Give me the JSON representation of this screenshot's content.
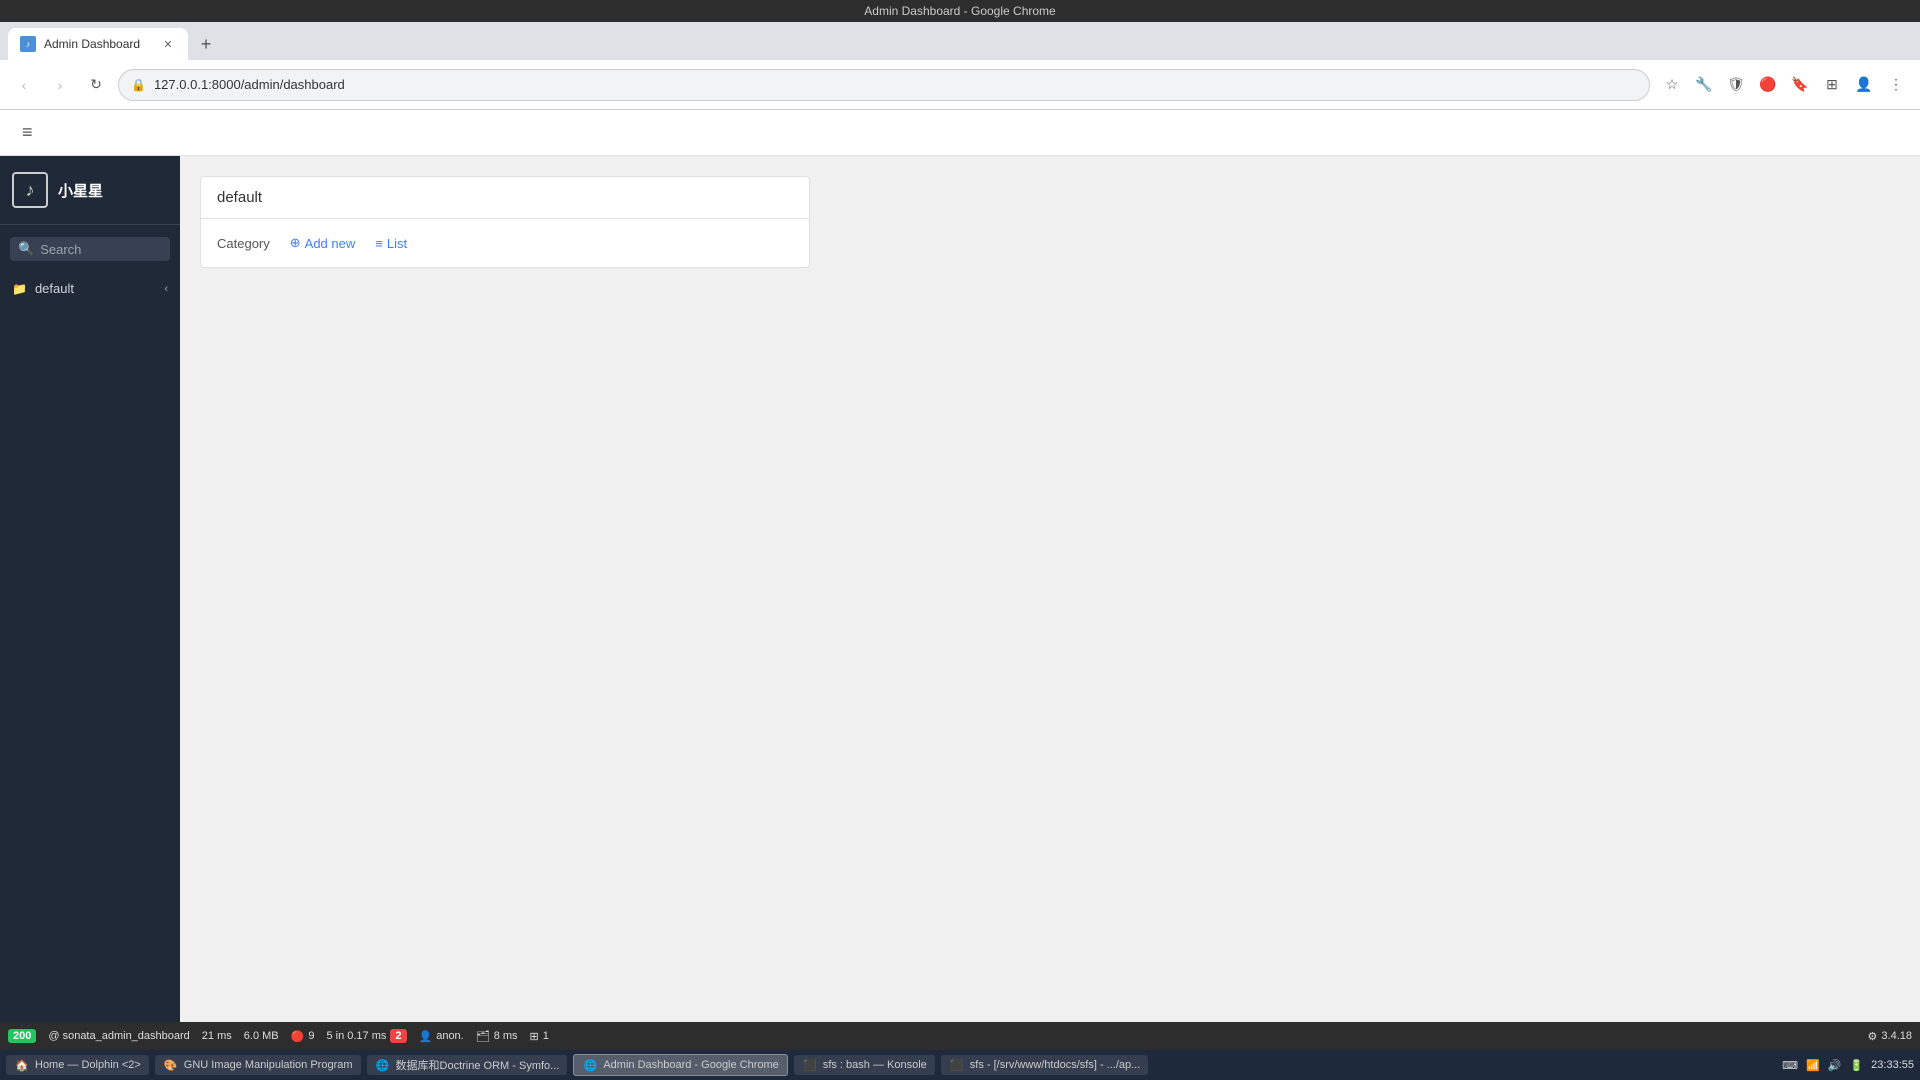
{
  "os_titlebar": {
    "title": "Admin Dashboard - Google Chrome"
  },
  "chrome": {
    "tab": {
      "label": "Admin Dashboard",
      "favicon": "♪"
    },
    "new_tab_icon": "+",
    "address": "127.0.0.1:8000/admin/dashboard",
    "nav": {
      "back": "‹",
      "forward": "›",
      "reload": "↻"
    }
  },
  "sidebar": {
    "logo_icon": "♪",
    "title": "小星星",
    "search_placeholder": "Search",
    "items": [
      {
        "label": "default",
        "icon": "📁",
        "collapsible": true,
        "collapse_icon": "‹"
      }
    ]
  },
  "main": {
    "hamburger_label": "≡",
    "dashboard_card": {
      "title": "default",
      "category_label": "Category",
      "add_new_label": "Add new",
      "add_new_icon": "⊕",
      "list_label": "List",
      "list_icon": "≡"
    }
  },
  "statusbar": {
    "status_code": "200",
    "route": "@ sonata_admin_dashboard",
    "time": "21 ms",
    "memory": "6.0 MB",
    "db_icon": "🔴",
    "db_count": "9",
    "events_count": "5 in 0.17 ms",
    "events_icon": "🔴",
    "events_err": "2",
    "user_icon": "👤",
    "user_label": "anon.",
    "cache_icon": "🗂",
    "cache_label": "8 ms",
    "grid_icon": "⊞",
    "grid_label": "1",
    "framework": "3.4.18"
  },
  "taskbar": {
    "items": [
      {
        "label": "Home — Dolphin <2>",
        "icon": "🏠"
      },
      {
        "label": "GNU Image Manipulation Program",
        "icon": "🎨"
      },
      {
        "label": "数据库和Doctrine ORM - Symfo...",
        "icon": "🌐"
      },
      {
        "label": "Admin Dashboard - Google Chrome",
        "icon": "🌐",
        "active": true
      },
      {
        "label": "sfs : bash — Konsole",
        "icon": "⬛"
      },
      {
        "label": "sfs - [/srv/www/htdocs/sfs] - .../ap...",
        "icon": "⬛"
      }
    ],
    "time": "23:33:55",
    "date": ""
  }
}
